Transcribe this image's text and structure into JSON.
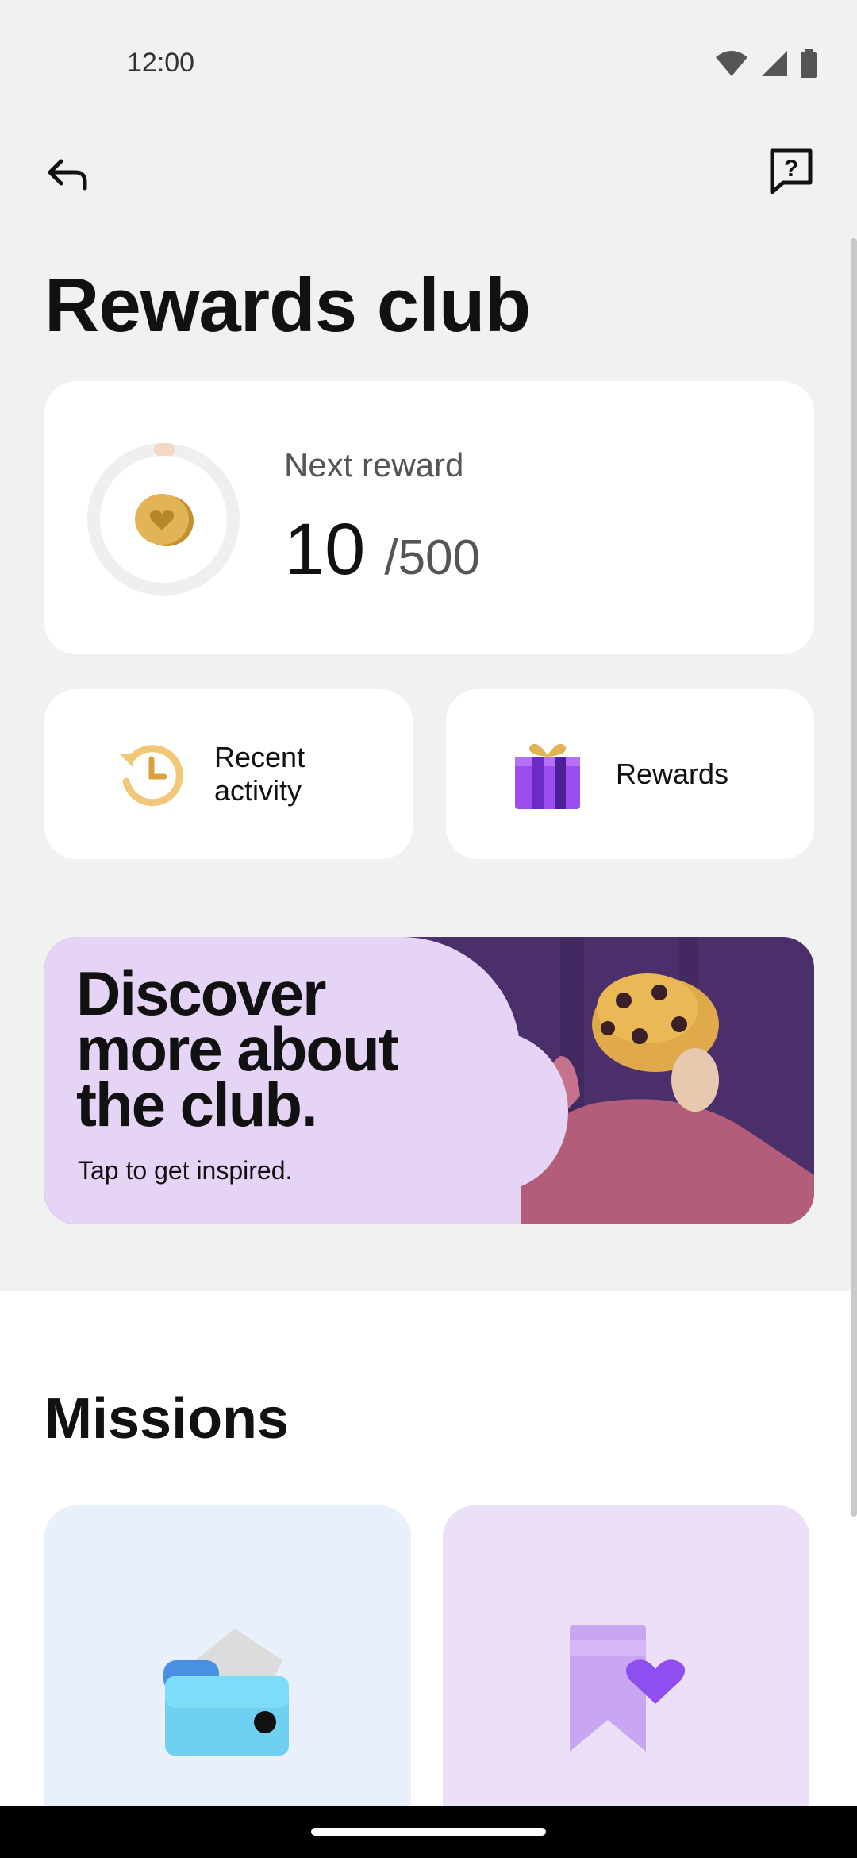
{
  "status_bar": {
    "time": "12:00"
  },
  "header": {
    "title": "Rewards club"
  },
  "reward_card": {
    "label": "Next reward",
    "points": "10",
    "total": "/500",
    "progress_fraction": 0.02
  },
  "actions": [
    {
      "label_line1": "Recent",
      "label_line2": "activity",
      "icon": "history-icon"
    },
    {
      "label": "Rewards",
      "icon": "gift-icon"
    }
  ],
  "banner": {
    "title_lines": [
      "Discover",
      "more about",
      "the club."
    ],
    "subtitle": "Tap to get inspired."
  },
  "missions": {
    "title": "Missions"
  },
  "colors": {
    "background": "#f0f1f1",
    "card": "#ffffff",
    "accent_purple": "#7b3fe4",
    "coin_gold": "#e3b456",
    "banner_lilac": "#e6d4f6"
  }
}
